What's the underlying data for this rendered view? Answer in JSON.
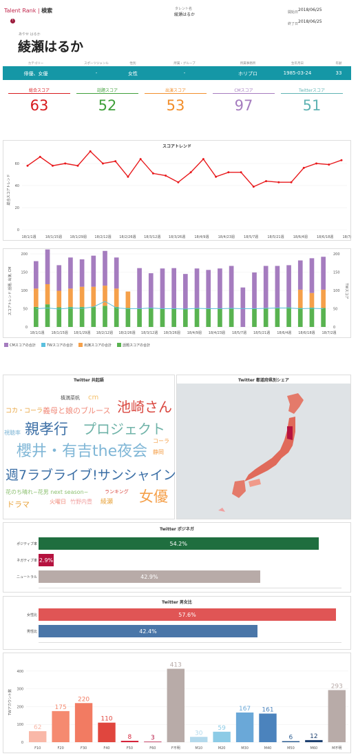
{
  "header": {
    "brand": "Talent Rank",
    "sep": " | ",
    "search": "検索",
    "talent_label": "タレント名",
    "talent_value": "綾瀬はるか",
    "start_label": "開始日",
    "start_value": "2018/06/25",
    "end_label": "終了日",
    "end_value": "2018/06/25",
    "alert": "!"
  },
  "profile": {
    "kana": "あやせ はるか",
    "name": "綾瀬はるか"
  },
  "info": {
    "labels": [
      "カテゴリー",
      "スポーツジャンル",
      "性別",
      "所属・グループ",
      "所属事務所",
      "生年月日",
      "年齢"
    ],
    "values": [
      "俳優、女優",
      "-",
      "女性",
      "-",
      "ホリプロ",
      "1985-03-24",
      "33"
    ]
  },
  "scores": [
    {
      "label": "総合スコア",
      "value": "63",
      "color": "#d7191c"
    },
    {
      "label": "話題スコア",
      "value": "52",
      "color": "#3f9f3a"
    },
    {
      "label": "出演スコア",
      "value": "53",
      "color": "#f28e2b"
    },
    {
      "label": "CMスコア",
      "value": "97",
      "color": "#a57cbf"
    },
    {
      "label": "Twitterスコア",
      "value": "51",
      "color": "#5fb3b3"
    }
  ],
  "trend": {
    "title": "スコアトレンド",
    "ylabel": "総合スコアトレンド",
    "yticks": [
      "0",
      "20",
      "40",
      "60"
    ],
    "xticks": [
      "18/1/1週",
      "18/1/15週",
      "18/1/29週",
      "18/2/12週",
      "18/2/26週",
      "18/3/12週",
      "18/3/26週",
      "18/4/9週",
      "18/4/23週",
      "18/5/7週",
      "18/5/21週",
      "18/6/4週",
      "18/6/18週",
      "18/7/2週"
    ]
  },
  "stack": {
    "ylabel_left": "スコアトレンド 話題, 出演, CM",
    "ylabel_right": "TWスコア",
    "yticks_left": [
      "0",
      "50",
      "100",
      "150",
      "200"
    ],
    "yticks_right": [
      "0",
      "50",
      "100",
      "150",
      "200"
    ],
    "xticks": [
      "18/1/1週",
      "18/1/15週",
      "18/1/29週",
      "18/2/12週",
      "18/2/26週",
      "18/3/12週",
      "18/3/26週",
      "18/4/9週",
      "18/4/23週",
      "18/5/7週",
      "18/5/21週",
      "18/6/4週",
      "18/6/18週",
      "18/7/2週"
    ],
    "legend": [
      "CMスコアの合計",
      "TWスコアの合計",
      "出演スコアの合計",
      "話題スコアの合計"
    ],
    "legend_colors": [
      "#a57cbf",
      "#5bc0de",
      "#f5a04a",
      "#59b350"
    ]
  },
  "wordcloud": {
    "title": "Twitter 共起語",
    "words": [
      {
        "text": "槙満菜帆",
        "color": "#555555"
      },
      {
        "text": "cm",
        "color": "#f5c06a"
      },
      {
        "text": "コカ・コーラ",
        "color": "#e8a33c"
      },
      {
        "text": "義母と娘のブルース",
        "color": "#f08a7a"
      },
      {
        "text": "池崎さん",
        "color": "#d9473f"
      },
      {
        "text": "視聴率",
        "color": "#7fb6d6"
      },
      {
        "text": "親孝行",
        "color": "#3a6ea5"
      },
      {
        "text": "プロジェクト",
        "color": "#6fb3a8"
      },
      {
        "text": "コーラ",
        "color": "#f5a04a"
      },
      {
        "text": "櫻井・有吉the夜会",
        "color": "#7fb6d6"
      },
      {
        "text": "静岡",
        "color": "#f5a04a"
      },
      {
        "text": "週7ラブライブ!サンシャイン!!",
        "color": "#3a6ea5"
      },
      {
        "text": "花のち晴れ~花男 next season~",
        "color": "#8cc070"
      },
      {
        "text": "ランキング",
        "color": "#d9473f"
      },
      {
        "text": "女優",
        "color": "#f5a04a"
      },
      {
        "text": "ドラマ",
        "color": "#e8a33c"
      },
      {
        "text": "火曜日",
        "color": "#f08a7a"
      },
      {
        "text": "竹野内豊",
        "color": "#f0a0a0"
      },
      {
        "text": "綾瀬",
        "color": "#e8a33c"
      }
    ]
  },
  "map": {
    "title": "Twitter 都道府県別シェア"
  },
  "posinega": {
    "title": "Twitter ポジネガ",
    "items": [
      {
        "label": "ポジティブ率",
        "value": "54.2%",
        "num": 54.2,
        "color": "#1f6e3f"
      },
      {
        "label": "ネガティブ率",
        "value": "2.9%",
        "num": 2.9,
        "color": "#b5123f"
      },
      {
        "label": "ニュートラル",
        "value": "42.9%",
        "num": 42.9,
        "color": "#b8aba8"
      }
    ]
  },
  "gender": {
    "title": "Twitter 男女比",
    "items": [
      {
        "label": "女性比",
        "value": "57.6%",
        "num": 57.6,
        "color": "#e05555"
      },
      {
        "label": "男性比",
        "value": "42.4%",
        "num": 42.4,
        "color": "#4a76a8"
      }
    ]
  },
  "chart_data": [
    {
      "type": "line",
      "title": "スコアトレンド",
      "ylabel": "総合スコアトレンド",
      "ylim": [
        0,
        70
      ],
      "x": [
        "18/1/1週",
        "",
        "18/1/15週",
        "",
        "18/1/29週",
        "",
        "18/2/12週",
        "",
        "18/2/26週",
        "",
        "18/3/12週",
        "",
        "18/3/26週",
        "",
        "18/4/9週",
        "",
        "18/4/23週",
        "",
        "18/5/7週",
        "",
        "18/5/21週",
        "",
        "18/6/4週",
        "",
        "18/6/18週",
        "",
        "18/7/2週"
      ],
      "series": [
        {
          "values": [
            58,
            66,
            58,
            60,
            58,
            71,
            60,
            62,
            48,
            64,
            51,
            49,
            43,
            52,
            64,
            48,
            52,
            52,
            39,
            44,
            43,
            43,
            56,
            60,
            59,
            63
          ],
          "color": "#e8191c"
        }
      ]
    },
    {
      "type": "bar",
      "stacked": true,
      "ylim": [
        0,
        200
      ],
      "series": [
        {
          "name": "話題スコアの合計",
          "color": "#59b350",
          "values": [
            55,
            62,
            54,
            55,
            55,
            55,
            58,
            55,
            52,
            51,
            52,
            50,
            51,
            50,
            50,
            51,
            50,
            52,
            0,
            51,
            52,
            52,
            54,
            52,
            53,
            52
          ]
        },
        {
          "name": "出演スコアの合計",
          "color": "#f5a04a",
          "values": [
            50,
            55,
            45,
            50,
            55,
            55,
            55,
            50,
            45,
            0,
            0,
            0,
            0,
            0,
            0,
            0,
            0,
            0,
            0,
            0,
            0,
            0,
            0,
            50,
            40,
            50,
            55
          ]
        },
        {
          "name": "CMスコアの合計",
          "color": "#a57cbf",
          "values": [
            75,
            95,
            70,
            85,
            75,
            85,
            95,
            85,
            0,
            110,
            95,
            110,
            110,
            95,
            110,
            105,
            110,
            115,
            108,
            98,
            115,
            115,
            115,
            80,
            95,
            90
          ]
        },
        {
          "name": "TWスコアの合計",
          "color": "#5bc0de",
          "values": [
            50,
            52,
            49,
            52,
            51,
            55,
            70,
            52,
            50,
            50,
            52,
            50,
            50,
            49,
            51,
            50,
            50,
            51,
            50,
            50,
            51,
            52,
            52,
            50,
            51,
            50
          ]
        }
      ]
    },
    {
      "type": "bar",
      "title": "Twitter ポジネガ",
      "categories": [
        "ポジティブ率",
        "ネガティブ率",
        "ニュートラル"
      ],
      "values": [
        54.2,
        2.9,
        42.9
      ]
    },
    {
      "type": "bar",
      "title": "Twitter 男女比",
      "categories": [
        "女性比",
        "男性比"
      ],
      "values": [
        57.6,
        42.4
      ]
    },
    {
      "type": "bar",
      "ylabel": "TWアカウント数",
      "ylim": [
        0,
        450
      ],
      "yticks": [
        "0",
        "100",
        "200",
        "300",
        "400"
      ],
      "categories": [
        "F10",
        "F20",
        "F30",
        "F40",
        "F50",
        "F60",
        "F不明",
        "M10",
        "M20",
        "M30",
        "M40",
        "M50",
        "M60",
        "M不明"
      ],
      "values": [
        62,
        175,
        220,
        110,
        8,
        3,
        413,
        30,
        59,
        167,
        161,
        6,
        12,
        293
      ],
      "colors": [
        "#f9b8a8",
        "#f58a70",
        "#f27b62",
        "#e0463e",
        "#d5243a",
        "#b5123f",
        "#b8aba8",
        "#b3d9ec",
        "#8ccbe6",
        "#6aa8d8",
        "#4b83bd",
        "#2f5f93",
        "#1e4170",
        "#b8aba8"
      ]
    }
  ]
}
